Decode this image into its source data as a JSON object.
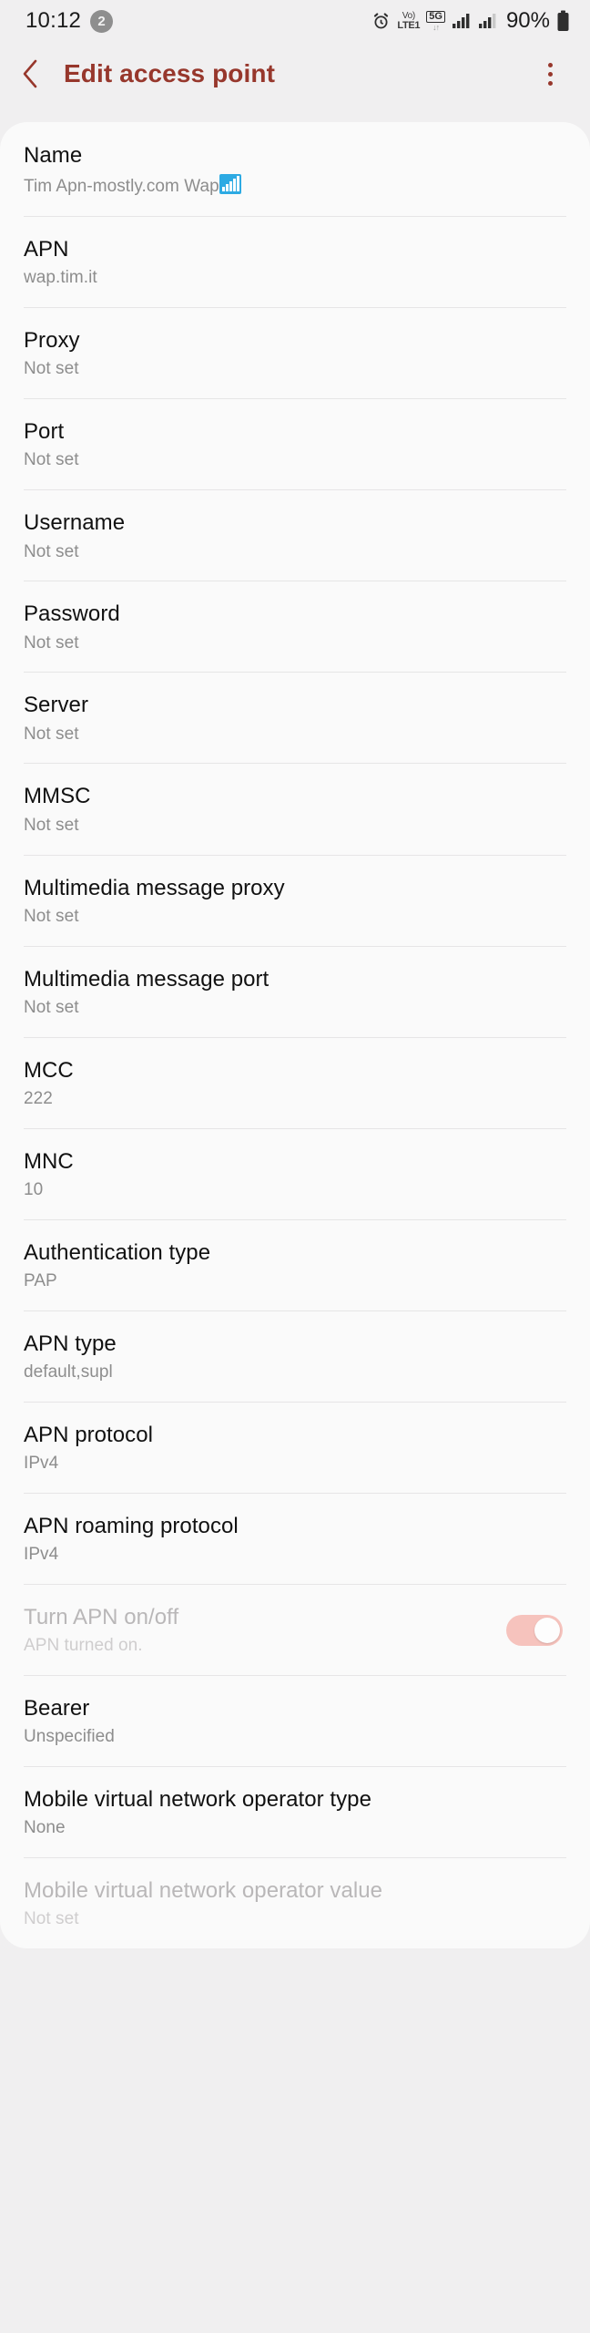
{
  "statusbar": {
    "time": "10:12",
    "notification_count": "2",
    "alarm_icon": "alarm-clock-icon",
    "volte_top": "Vo)",
    "volte_bottom": "LTE1",
    "network_label": "5G",
    "data_arrows": "↓↑",
    "signal_icon_1": "signal-bars-icon",
    "signal_icon_2": "signal-bars-icon",
    "battery_percent": "90%",
    "battery_icon": "battery-icon"
  },
  "header": {
    "back_icon": "chevron-left-icon",
    "title": "Edit access point",
    "overflow_icon": "more-vertical-icon"
  },
  "settings": {
    "rows": [
      {
        "label": "Name",
        "value": "Tim Apn-mostly.com Wap",
        "selected_emoji": "signal-bars-emoji",
        "dim": false,
        "toggle": null
      },
      {
        "label": "APN",
        "value": "wap.tim.it",
        "dim": false,
        "toggle": null
      },
      {
        "label": "Proxy",
        "value": "Not set",
        "dim": false,
        "toggle": null
      },
      {
        "label": "Port",
        "value": "Not set",
        "dim": false,
        "toggle": null
      },
      {
        "label": "Username",
        "value": "Not set",
        "dim": false,
        "toggle": null
      },
      {
        "label": "Password",
        "value": "Not set",
        "dim": false,
        "toggle": null
      },
      {
        "label": "Server",
        "value": "Not set",
        "dim": false,
        "toggle": null
      },
      {
        "label": "MMSC",
        "value": "Not set",
        "dim": false,
        "toggle": null
      },
      {
        "label": "Multimedia message proxy",
        "value": "Not set",
        "dim": false,
        "toggle": null
      },
      {
        "label": "Multimedia message port",
        "value": "Not set",
        "dim": false,
        "toggle": null
      },
      {
        "label": "MCC",
        "value": "222",
        "dim": false,
        "toggle": null
      },
      {
        "label": "MNC",
        "value": "10",
        "dim": false,
        "toggle": null
      },
      {
        "label": "Authentication type",
        "value": "PAP",
        "dim": false,
        "toggle": null
      },
      {
        "label": "APN type",
        "value": "default,supl",
        "dim": false,
        "toggle": null
      },
      {
        "label": "APN protocol",
        "value": "IPv4",
        "dim": false,
        "toggle": null
      },
      {
        "label": "APN roaming protocol",
        "value": "IPv4",
        "dim": false,
        "toggle": null
      },
      {
        "label": "Turn APN on/off",
        "value": "APN turned on.",
        "dim": true,
        "toggle": "on"
      },
      {
        "label": "Bearer",
        "value": "Unspecified",
        "dim": false,
        "toggle": null
      },
      {
        "label": "Mobile virtual network operator type",
        "value": "None",
        "dim": false,
        "toggle": null
      },
      {
        "label": "Mobile virtual network operator value",
        "value": "Not set",
        "dim": true,
        "toggle": null
      }
    ]
  },
  "colors": {
    "accent": "#97372c",
    "page_background": "#f0eff0",
    "card_background": "#fafafa",
    "toggle_on": "#f6c3bd",
    "selection_highlight": "#2daae3"
  }
}
